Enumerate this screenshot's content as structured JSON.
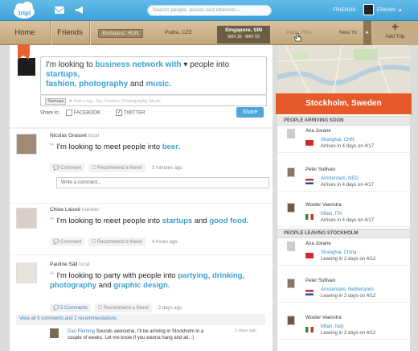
{
  "app": {
    "logo_text": "tripl"
  },
  "topbar": {
    "search_placeholder": "Search people, places and interests...",
    "friends_label": "FRIENDS",
    "user_label": "ERHAN"
  },
  "nav": {
    "home": "Home",
    "friends": "Friends",
    "trips": [
      {
        "city": "Budapest, HUN",
        "dates": ""
      },
      {
        "city": "Praha, CZE",
        "dates": ""
      },
      {
        "city": "Singapore, SIN",
        "dates": "MAY 26 · MAY 03"
      },
      {
        "city": "Paris, FRA",
        "dates": ""
      },
      {
        "city": "New Yo",
        "dates": ""
      }
    ],
    "add_trip": "Add Trip"
  },
  "compose": {
    "prefix": "I'm looking to",
    "verb": "business network with",
    "mid": "people into",
    "interests": "startups,",
    "interests2": "fashion, photography",
    "and": "and",
    "interests3": "music.",
    "tag": "Startups",
    "tag_placeholder": "Add a tag - Eg. Fashion, Photography, Music",
    "share_to": "Share to:",
    "facebook": "FACEBOOK",
    "twitter": "TWITTER",
    "share_button": "Share"
  },
  "posts": [
    {
      "name": "Nicolas Grasset",
      "type": "local",
      "text_a": "I'm looking to meet people into",
      "link1": "beer",
      "text_b": ".",
      "comment": "Comment",
      "recommend": "Recommend a friend",
      "time": "3 minutes ago",
      "comment_placeholder": "Write a comment..."
    },
    {
      "name": "Chloe Laisné",
      "type": "traveler",
      "text_a": "I'm looking to meet people into",
      "link1": "startups",
      "text_b": "and",
      "link2": "good food",
      "text_c": ".",
      "comment": "Comment",
      "recommend": "Recommend a friend",
      "time": "4 hours ago"
    },
    {
      "name": "Pauline Säll",
      "type": "local",
      "text_a": "I'm looking to party with people into",
      "link1": "partying",
      "link2": "drinking",
      "link3": "photography",
      "link4": "graphic design",
      "comment": "5 Comments",
      "recommend": "Recommend a friend",
      "time": "2 days ago",
      "view_all": "View all 5 comments and 2 recommendations"
    }
  ],
  "reply": {
    "author": "Dan Fleming",
    "text": "Sounds awesome, I'll be arriving in Stockholm in a couple of weeks. Let me know if you wanna hang and all. :)",
    "time": "2 days ago"
  },
  "sidebar": {
    "city": "Stockholm, Sweden",
    "arriving_title": "PEOPLE ARRIVING SOON",
    "leaving_title": "PEOPLE LEAVING STOCKHOLM",
    "arriving": [
      {
        "name": "Ana Jovane",
        "city": "Shanghai, CHN",
        "info": "Arrives in 4 days on 4/17"
      },
      {
        "name": "Peter Sullivan",
        "city": "Amsterdam, NED",
        "info": "Arrives in 4 days on 4/17"
      },
      {
        "name": "Wouter Veenstra",
        "city": "Milan, ITA",
        "info": "Arrives in 4 days on 4/17"
      }
    ],
    "leaving": [
      {
        "name": "Ana Jovane",
        "city": "Shanghai, China",
        "info": "Leaving in 2 days on 4/12"
      },
      {
        "name": "Peter Sullivan",
        "city": "Amsterdam, Netherlands",
        "info": "Leaving in 2 days on 4/12"
      },
      {
        "name": "Wouter Veenstra",
        "city": "Milan, Italy",
        "info": "Leaving in 2 days on 4/12"
      }
    ]
  }
}
